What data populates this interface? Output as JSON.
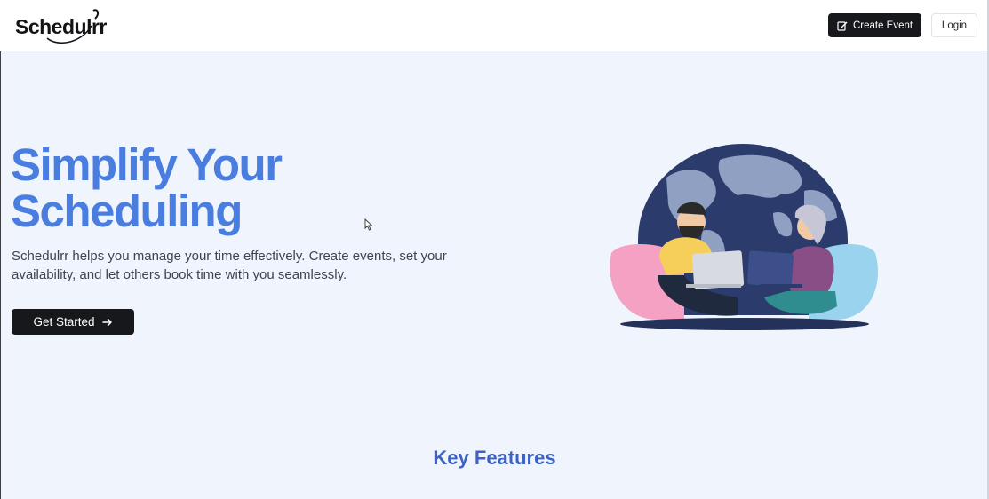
{
  "header": {
    "logo_text": "Schedulrr",
    "create_event_label": "Create Event",
    "login_label": "Login"
  },
  "hero": {
    "title_line1": "Simplify Your",
    "title_line2": "Scheduling",
    "description": "Schedulrr helps you manage your time effectively. Create events, set your availability, and let others book time with you seamlessly.",
    "cta_label": "Get Started"
  },
  "features": {
    "title": "Key Features"
  },
  "colors": {
    "brand_blue": "#4a7de0",
    "dark_button": "#17181b",
    "background": "#eff4fd"
  },
  "icons": {
    "create_event": "edit-icon",
    "cta": "arrow-right-icon"
  }
}
